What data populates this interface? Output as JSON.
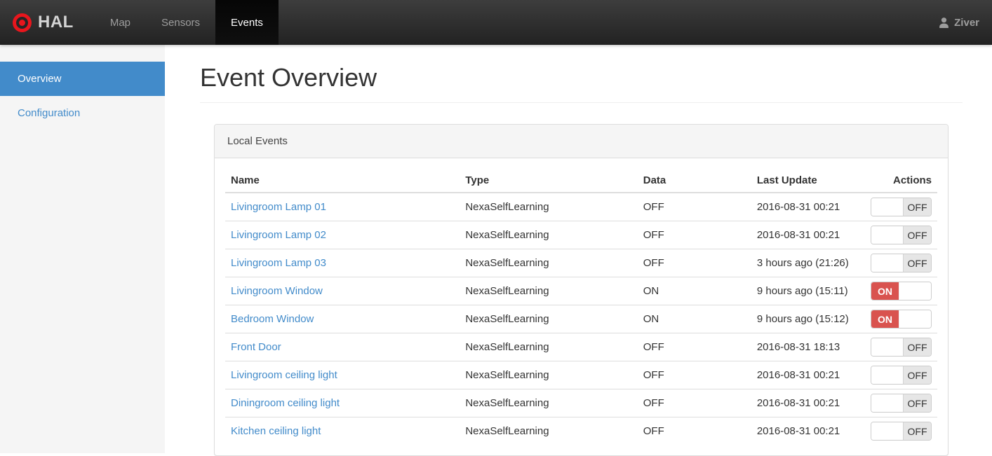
{
  "navbar": {
    "brand": "HAL",
    "items": [
      {
        "label": "Map",
        "active": false
      },
      {
        "label": "Sensors",
        "active": false
      },
      {
        "label": "Events",
        "active": true
      }
    ],
    "user": "Ziver"
  },
  "sidebar": {
    "items": [
      {
        "label": "Overview",
        "active": true
      },
      {
        "label": "Configuration",
        "active": false
      }
    ]
  },
  "main": {
    "title": "Event Overview",
    "panel": {
      "title": "Local Events",
      "table": {
        "columns": [
          "Name",
          "Type",
          "Data",
          "Last Update",
          "Actions"
        ],
        "rows": [
          {
            "name": "Livingroom Lamp 01",
            "type": "NexaSelfLearning",
            "data": "OFF",
            "last_update": "2016-08-31 00:21",
            "switch": "OFF"
          },
          {
            "name": "Livingroom Lamp 02",
            "type": "NexaSelfLearning",
            "data": "OFF",
            "last_update": "2016-08-31 00:21",
            "switch": "OFF"
          },
          {
            "name": "Livingroom Lamp 03",
            "type": "NexaSelfLearning",
            "data": "OFF",
            "last_update": "3 hours ago (21:26)",
            "switch": "OFF"
          },
          {
            "name": "Livingroom Window",
            "type": "NexaSelfLearning",
            "data": "ON",
            "last_update": "9 hours ago (15:11)",
            "switch": "ON"
          },
          {
            "name": "Bedroom Window",
            "type": "NexaSelfLearning",
            "data": "ON",
            "last_update": "9 hours ago (15:12)",
            "switch": "ON"
          },
          {
            "name": "Front Door",
            "type": "NexaSelfLearning",
            "data": "OFF",
            "last_update": "2016-08-31 18:13",
            "switch": "OFF"
          },
          {
            "name": "Livingroom ceiling light",
            "type": "NexaSelfLearning",
            "data": "OFF",
            "last_update": "2016-08-31 00:21",
            "switch": "OFF"
          },
          {
            "name": "Diningroom ceiling light",
            "type": "NexaSelfLearning",
            "data": "OFF",
            "last_update": "2016-08-31 00:21",
            "switch": "OFF"
          },
          {
            "name": "Kitchen ceiling light",
            "type": "NexaSelfLearning",
            "data": "OFF",
            "last_update": "2016-08-31 00:21",
            "switch": "OFF"
          }
        ]
      }
    }
  },
  "icons": {
    "brand": "bullseye-icon",
    "user": "person-icon"
  },
  "colors": {
    "accent_blue": "#428bca",
    "switch_on_red": "#d9534f",
    "navbar_dark": "#222222",
    "logo_red": "#e8161d",
    "sidebar_bg": "#f5f5f5",
    "panel_border": "#dddddd"
  }
}
